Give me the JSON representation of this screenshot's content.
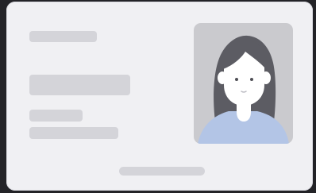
{
  "card": {
    "kind": "id-card-placeholder",
    "colors": {
      "background": "#232327",
      "card": "#f0f0f3",
      "placeholder_bar": "#d4d4d9",
      "photo_background": "#cacace",
      "hair": "#5c5c63",
      "skin": "#ffffff",
      "shirt": "#b3c5e6"
    },
    "placeholder_lines": [
      {
        "role": "label-line"
      },
      {
        "role": "name-line"
      },
      {
        "role": "detail-line-1"
      },
      {
        "role": "detail-line-2"
      },
      {
        "role": "footer-line"
      }
    ],
    "photo": {
      "icon": "person-avatar-icon"
    }
  }
}
